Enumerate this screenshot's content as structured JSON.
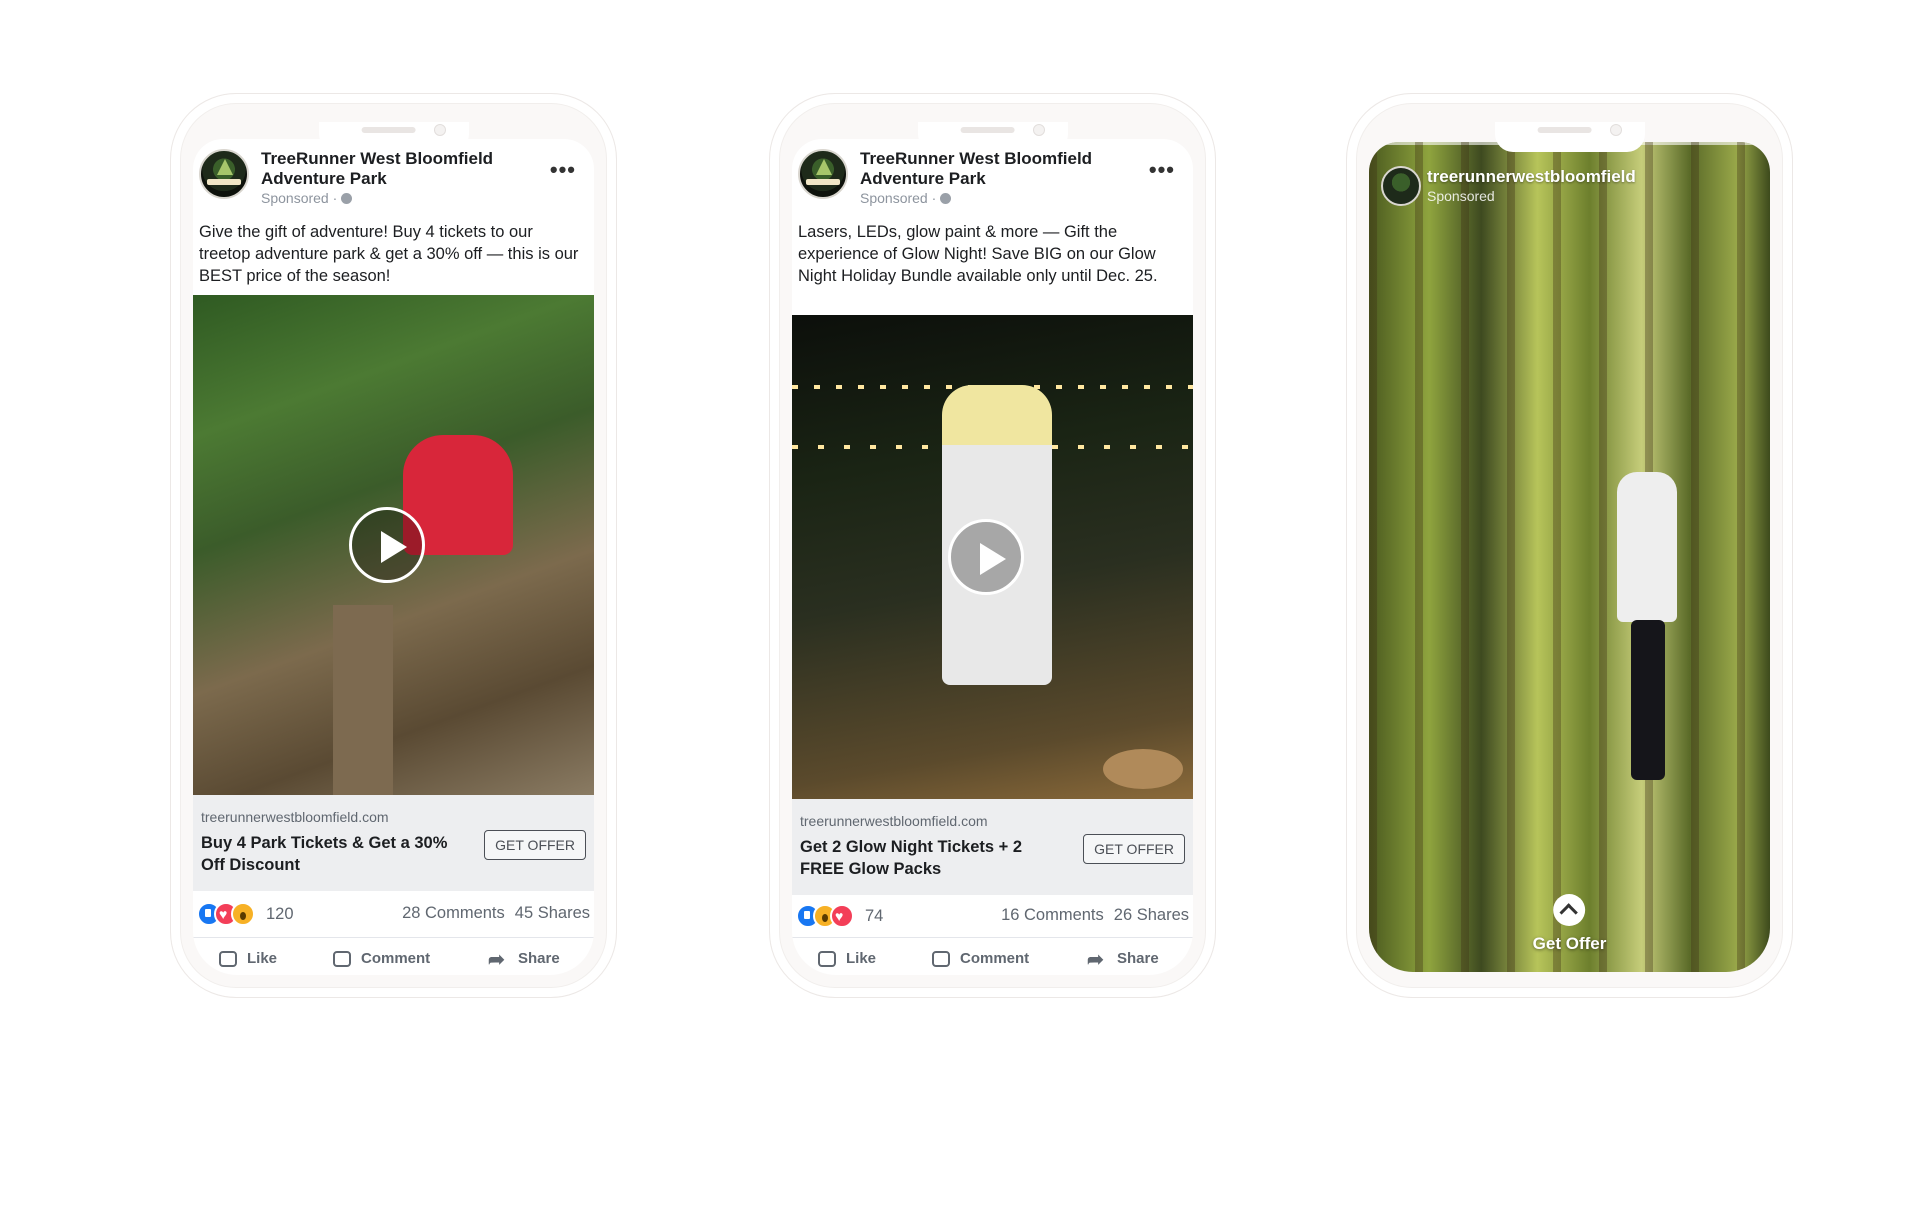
{
  "ads": [
    {
      "page_name": "TreeRunner West Bloomfield Adventure Park",
      "sponsored": "Sponsored ·",
      "menu": "•••",
      "caption": "Give the gift of adventure! Buy 4 tickets to our treetop adventure park & get a 30% off — this is our BEST price of the season!",
      "domain": "treerunnerwestbloomfield.com",
      "headline": "Buy 4 Park Tickets & Get a 30% Off Discount",
      "cta": "GET OFFER",
      "reaction_count": "120",
      "comments": "28 Comments",
      "shares": "45 Shares",
      "like": "Like",
      "comment": "Comment",
      "share": "Share"
    },
    {
      "page_name": "TreeRunner West Bloomfield Adventure Park",
      "sponsored": "Sponsored ·",
      "menu": "•••",
      "caption": "Lasers, LEDs, glow paint & more — Gift the experience of Glow Night! Save BIG on our Glow Night Holiday Bundle available only until Dec. 25.",
      "domain": "treerunnerwestbloomfield.com",
      "headline": "Get 2 Glow Night Tickets + 2 FREE Glow Packs",
      "cta": "GET OFFER",
      "reaction_count": "74",
      "comments": "16 Comments",
      "shares": "26 Shares",
      "like": "Like",
      "comment": "Comment",
      "share": "Share"
    }
  ],
  "story": {
    "username": "treerunnerwestbloomfield",
    "sponsored": "Sponsored",
    "cta": "Get Offer"
  }
}
